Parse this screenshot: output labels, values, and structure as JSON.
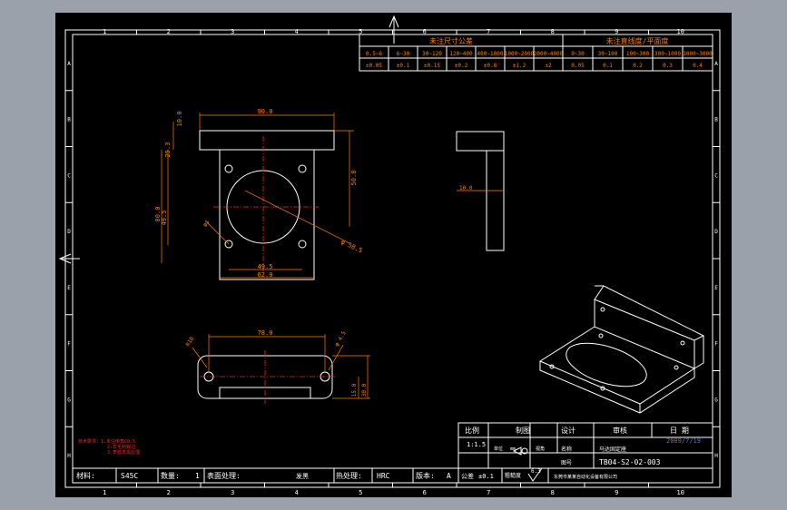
{
  "colors": {
    "background": "#000000",
    "frame": "#ffffff",
    "dimension": "#ff7f00",
    "centerline": "#ff2020",
    "note": "#ff2020",
    "title_text": "#ffffff",
    "date": "#4a7bd0"
  },
  "border": {
    "col_numbers": [
      "1",
      "2",
      "3",
      "4",
      "5",
      "6",
      "7",
      "8",
      "9",
      "10"
    ],
    "row_letters": [
      "A",
      "B",
      "C",
      "D",
      "E",
      "F",
      "G",
      "H"
    ]
  },
  "tolerance_table": {
    "title_left": "未注尺寸公差",
    "title_right": "未注直线度/平面度",
    "ranges_left": [
      "0.5~6",
      "6~30",
      "30~120",
      "120~400",
      "400~1000",
      "1000~2000",
      "2000~4000"
    ],
    "values_left": [
      "±0.05",
      "±0.1",
      "±0.15",
      "±0.2",
      "±0.8",
      "±1.2",
      "±2"
    ],
    "ranges_right": [
      "0~30",
      "30~100",
      "100~300",
      "300~1000",
      "1000~3000"
    ],
    "values_right": [
      "0.05",
      "0.1",
      "0.2",
      "0.3",
      "0.4"
    ]
  },
  "dims": {
    "front_width": "90.0",
    "front_height_total": "50.8",
    "front_side_a": "80.0",
    "front_side_b": "49.5",
    "top_flange": "10.0",
    "flange_offset": "25.3",
    "hole_dia": "φ5",
    "bore_dia": "φ 58.5",
    "bottom_a": "49.5",
    "bottom_b": "62.0",
    "side_width": "10.0",
    "bottom_view_width": "78.0",
    "hole_r": "R10",
    "hole_small": "φ 4.5",
    "bottom_h1": "15.0",
    "bottom_h2": "30.0"
  },
  "notes": [
    "技术要求：1.未注倒角C0.5",
    "2.去毛刺锐边",
    "3.表面发黑处理"
  ],
  "title_block": {
    "scale_label": "比例",
    "scale_value": "1:1.5",
    "draw_label": "制图",
    "design_label": "设计",
    "check_label": "审核",
    "date_label": "日 期",
    "date_value": "2009/7/19",
    "projection_label": "视角",
    "name_label": "名称",
    "name_value": "马达固定座",
    "number_label": "图号",
    "number_value": "TB04-S2-02-003",
    "unit_label": "单位",
    "unit_value": "mm",
    "tolerance_label": "公差",
    "tolerance_value": "±0.1",
    "roughness_label": "粗糙度",
    "roughness_value": "6.3",
    "company_label": "东莞市某某自动化设备有限公司",
    "material_label": "材料:",
    "material_value": "S45C",
    "qty_label": "数量:",
    "qty_value": "1",
    "surface_label": "表面处理:",
    "surface_value": "发黑",
    "heat_label": "热处理:",
    "heat_value": "HRC",
    "version_label": "版本:",
    "version_value": "A"
  }
}
